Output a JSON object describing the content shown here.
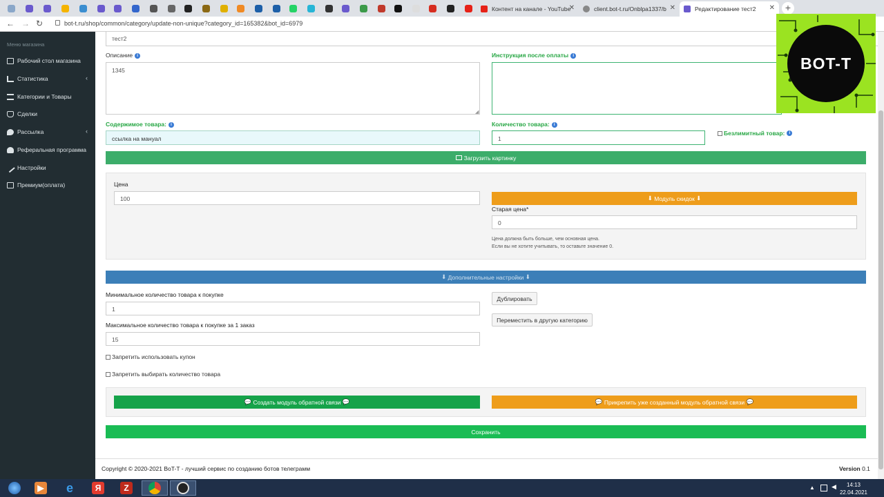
{
  "browser": {
    "tabs": [
      {
        "label": "Контент на канале - YouTube"
      },
      {
        "label": "client.bot-t.ru/Onblpa1337/b"
      },
      {
        "label": "Редактирование тест2"
      }
    ],
    "url": "bot-t.ru/shop/common/category/update-non-unique?category_id=165382&bot_id=6979",
    "newtab": "+"
  },
  "sidebar": {
    "header": "Меню магазина",
    "items": [
      {
        "label": "Рабочий стол магазина"
      },
      {
        "label": "Статистика",
        "arrow": "‹"
      },
      {
        "label": "Категории и Товары"
      },
      {
        "label": "Сделки"
      },
      {
        "label": "Рассылка",
        "arrow": "‹"
      },
      {
        "label": "Реферальная программа"
      },
      {
        "label": "Настройки"
      },
      {
        "label": "Премиум(оплата)"
      }
    ]
  },
  "form": {
    "name_value": "тест2",
    "description_label": "Описание",
    "description_value": "1345",
    "instruction_label": "Инструкция после оплаты",
    "content_label": "Содержимое товара:",
    "content_value": "ссылка на мануал",
    "quantity_label": "Количество товара:",
    "quantity_value": "1",
    "unlimited_label": "Безлимитный товар:",
    "upload_button": "Загрузить картинку",
    "price_label": "Цена",
    "price_value": "100",
    "discount_button": "Модуль скидок",
    "old_price_label": "Старая цена*",
    "old_price_value": "0",
    "old_price_hint_1": "Цена должна быть больше, чем основная цена.",
    "old_price_hint_2": "Если вы не хотите учитывать, то оставьте значение 0.",
    "extra_settings_button": "Дополнительные настройки",
    "min_label": "Минимальное количество товара к покупке",
    "min_value": "1",
    "max_label": "Максимальное количество товара к покупке за 1 заказ",
    "max_value": "15",
    "duplicate_button": "Дублировать",
    "move_button": "Переместить в другую категорию",
    "no_coupon_label": "Запретить использовать купон",
    "no_qty_label": "Запретить выбирать количество товара",
    "create_feedback_button": "Создать модуль обратной связи",
    "attach_feedback_button": "Прикрепить уже созданный модуль обратной связи",
    "save_button": "Сохранить"
  },
  "footer": {
    "copyright": "Copyright © 2020-2021 BoT-T - лучший сервис по созданию ботов телеграмм",
    "version_label": "Version",
    "version_value": "0.1"
  },
  "logo": {
    "text": "BOT-T"
  },
  "taskbar": {
    "time": "14:13",
    "date": "22.04.2021"
  },
  "colors": {
    "green": "#28a745",
    "orange": "#f0a023",
    "blue": "#3c7fb8",
    "sidebar": "#222d32"
  }
}
